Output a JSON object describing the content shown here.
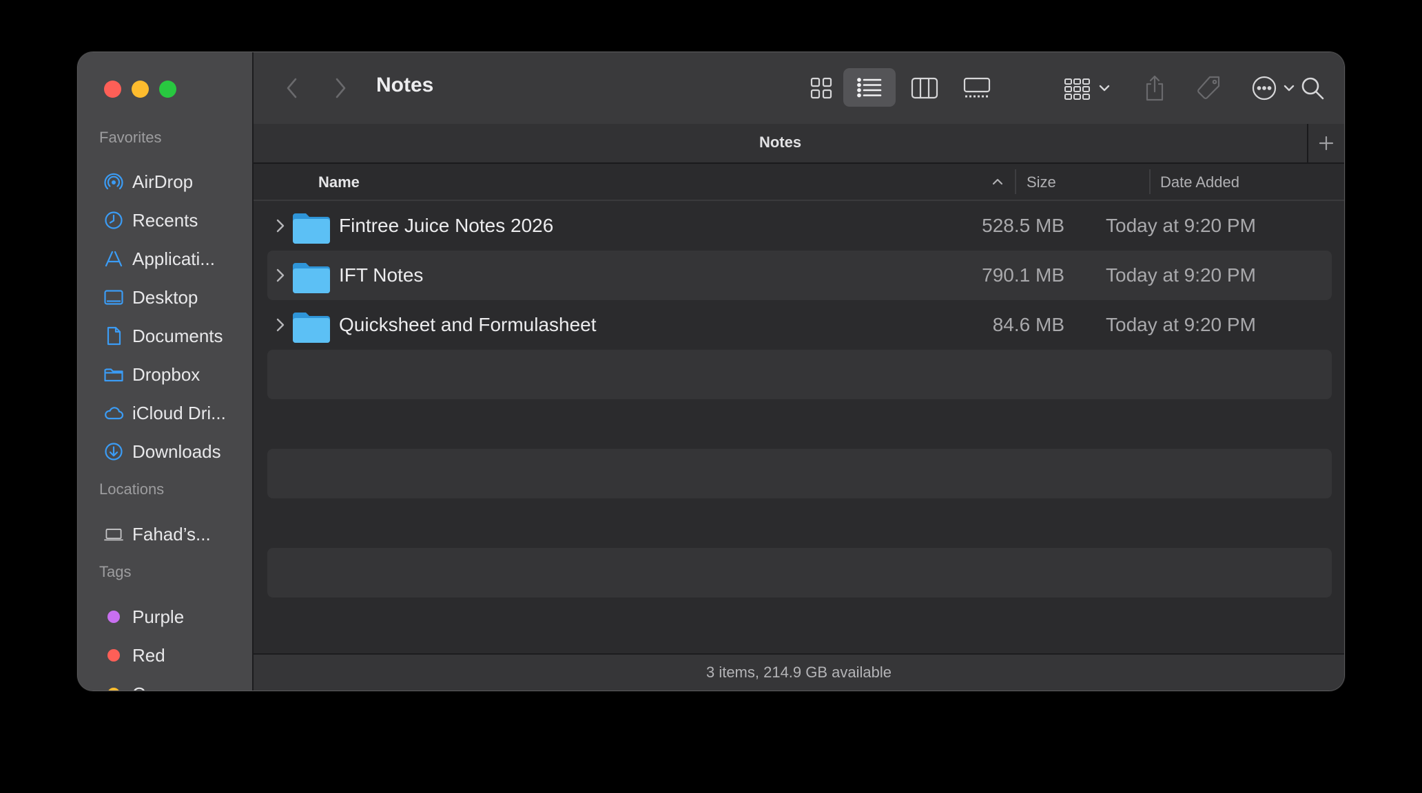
{
  "window": {
    "title": "Notes"
  },
  "sidebar": {
    "favorites_heading": "Favorites",
    "favorites": [
      {
        "label": "AirDrop",
        "icon": "airdrop-icon"
      },
      {
        "label": "Recents",
        "icon": "clock-icon"
      },
      {
        "label": "Applicati...",
        "icon": "applications-icon"
      },
      {
        "label": "Desktop",
        "icon": "desktop-icon"
      },
      {
        "label": "Documents",
        "icon": "document-icon"
      },
      {
        "label": "Dropbox",
        "icon": "folder-icon"
      },
      {
        "label": "iCloud Dri...",
        "icon": "cloud-icon"
      },
      {
        "label": "Downloads",
        "icon": "download-icon"
      }
    ],
    "locations_heading": "Locations",
    "locations": [
      {
        "label": "Fahad’s...",
        "icon": "laptop-icon"
      }
    ],
    "tags_heading": "Tags",
    "tags": [
      {
        "label": "Purple",
        "color": "#c86ff0"
      },
      {
        "label": "Red",
        "color": "#fe5f57"
      },
      {
        "label": "Orange",
        "color": "#febc2e"
      }
    ]
  },
  "toolbar": {
    "title": "Notes",
    "view_mode_selected": "list"
  },
  "pathbar": {
    "tab_title": "Notes"
  },
  "columns": {
    "name": "Name",
    "size": "Size",
    "date_added": "Date Added"
  },
  "files": [
    {
      "name": "Fintree Juice Notes 2026",
      "size": "528.5 MB",
      "date_added": "Today at 9:20 PM"
    },
    {
      "name": "IFT Notes",
      "size": "790.1 MB",
      "date_added": "Today at 9:20 PM"
    },
    {
      "name": "Quicksheet and Formulasheet",
      "size": "84.6 MB",
      "date_added": "Today at 9:20 PM"
    }
  ],
  "status": {
    "text": "3 items, 214.9 GB available"
  },
  "colors": {
    "accent": "#3b9cf5",
    "folder": "#4fb3f0"
  }
}
